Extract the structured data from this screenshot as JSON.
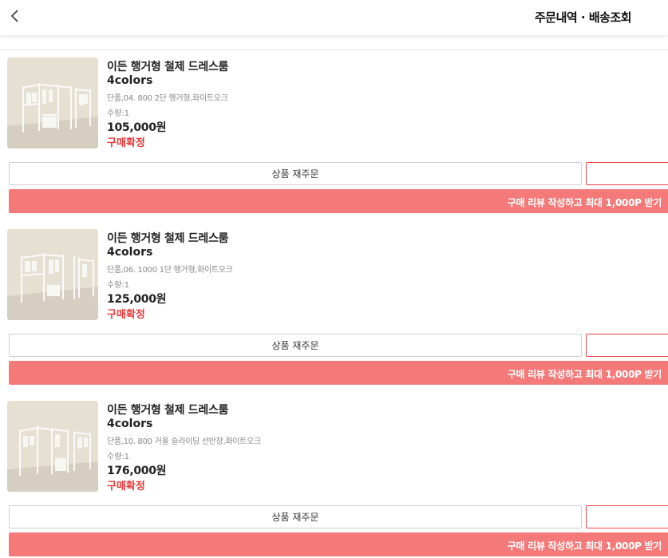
{
  "header": {
    "title": "주문내역 · 배송조회",
    "back_icon": "chevron-left-icon"
  },
  "orders": [
    {
      "name": "이든 행거형 철제 드레스룸",
      "subtitle": "4colors",
      "option": "단품,04. 800 2단 행거형,화이트오크",
      "quantity": "수량:1",
      "price": "105,000원",
      "status": "구매확정",
      "reorder_label": "상품 재주문",
      "review_label": "구매 리뷰 작성하고 최대 1,000P 받기"
    },
    {
      "name": "이든 행거형 철제 드레스룸",
      "subtitle": "4colors",
      "option": "단품,06. 1000 1단 행거형,화이트오크",
      "quantity": "수량:1",
      "price": "125,000원",
      "status": "구매확정",
      "reorder_label": "상품 재주문",
      "review_label": "구매 리뷰 작성하고 최대 1,000P 받기"
    },
    {
      "name": "이든 행거형 철제 드레스룸",
      "subtitle": "4colors",
      "option": "단품,10. 800 거울 슬라이딩 선반장,화이트오크",
      "quantity": "수량:1",
      "price": "176,000원",
      "status": "구매확정",
      "reorder_label": "상품 재주문",
      "review_label": "구매 리뷰 작성하고 최대 1,000P 받기"
    }
  ],
  "colors": {
    "accent": "#e63b3b",
    "review_bg": "#f47a7a",
    "border": "#cfcfcf"
  }
}
